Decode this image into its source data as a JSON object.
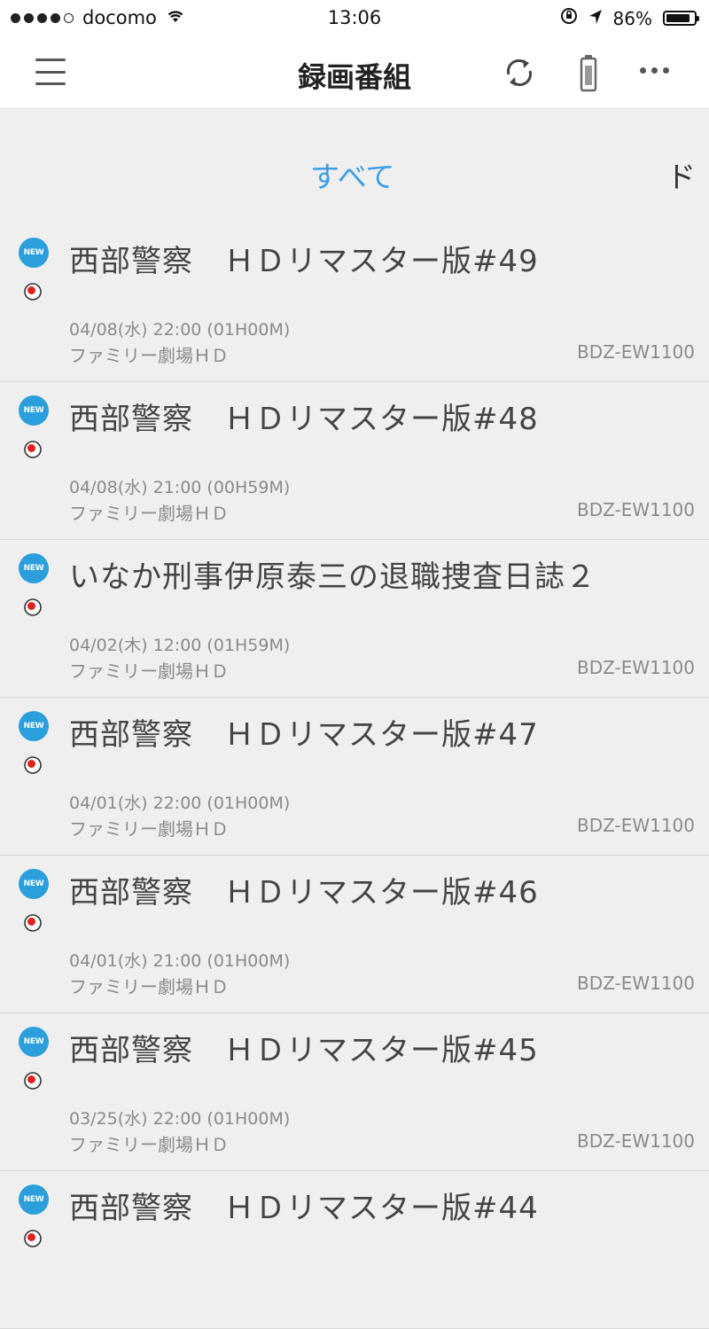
{
  "status_bar": {
    "carrier": "docomo",
    "time": "13:06",
    "battery_text": "86%",
    "battery_level": 0.86
  },
  "nav_bar": {
    "title": "録画番組",
    "icons": [
      "menu-icon",
      "refresh-icon",
      "remote-icon",
      "more-icon"
    ]
  },
  "tabs": [
    {
      "label": "すべて",
      "active": true
    },
    {
      "label": "ド",
      "active": false
    }
  ],
  "colors": {
    "accent": "#3a9de8",
    "new_badge": "#2b9fdc",
    "rec_red": "#e02020",
    "background": "#efefef"
  },
  "badge_text": "NEW",
  "recordings": [
    {
      "title": "西部警察　ＨＤリマスター版#49",
      "datetime": "04/08(水) 22:00 (01H00M)",
      "channel": "ファミリー劇場ＨＤ",
      "device": "BDZ-EW1100"
    },
    {
      "title": "西部警察　ＨＤリマスター版#48",
      "datetime": "04/08(水) 21:00 (00H59M)",
      "channel": "ファミリー劇場ＨＤ",
      "device": "BDZ-EW1100"
    },
    {
      "title": "いなか刑事伊原泰三の退職捜査日誌２",
      "datetime": "04/02(木) 12:00 (01H59M)",
      "channel": "ファミリー劇場ＨＤ",
      "device": "BDZ-EW1100"
    },
    {
      "title": "西部警察　ＨＤリマスター版#47",
      "datetime": "04/01(水) 22:00 (01H00M)",
      "channel": "ファミリー劇場ＨＤ",
      "device": "BDZ-EW1100"
    },
    {
      "title": "西部警察　ＨＤリマスター版#46",
      "datetime": "04/01(水) 21:00 (01H00M)",
      "channel": "ファミリー劇場ＨＤ",
      "device": "BDZ-EW1100"
    },
    {
      "title": "西部警察　ＨＤリマスター版#45",
      "datetime": "03/25(水) 22:00 (01H00M)",
      "channel": "ファミリー劇場ＨＤ",
      "device": "BDZ-EW1100"
    },
    {
      "title": "西部警察　ＨＤリマスター版#44",
      "datetime": "",
      "channel": "",
      "device": ""
    }
  ]
}
